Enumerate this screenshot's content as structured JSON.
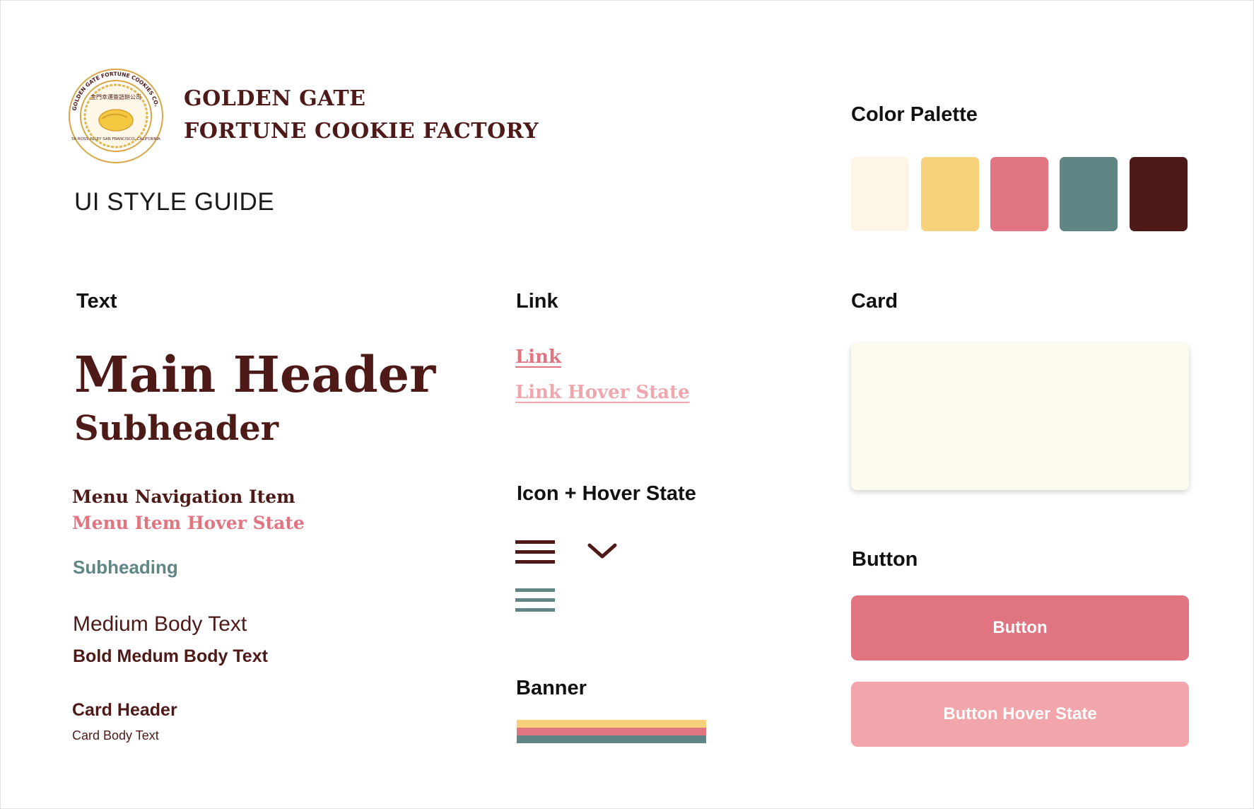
{
  "brand": {
    "line1": "GOLDEN GATE",
    "line2": "FORTUNE COOKIE FACTORY",
    "logo_ring_text": "GOLDEN GATE FORTUNE COOKIES CO.",
    "logo_bottom_text": "56 ROSS ALLEY SAN FRANCISCO, CALIFORNIA",
    "logo_chinese": "金門幸運簽語餅公司"
  },
  "guide_title": "UI STYLE GUIDE",
  "sections": {
    "text": "Text",
    "link": "Link",
    "icon": "Icon + Hover State",
    "banner": "Banner",
    "color_palette": "Color Palette",
    "card": "Card",
    "button": "Button"
  },
  "text_samples": {
    "main_header": "Main Header",
    "subheader": "Subheader",
    "menu_item": "Menu Navigation Item",
    "menu_hover": "Menu Item Hover State",
    "subheading": "Subheading",
    "medium_body": "Medium Body Text",
    "bold_body": "Bold Medum Body Text",
    "card_header": "Card Header",
    "card_body": "Card Body Text"
  },
  "links": {
    "link": "Link",
    "link_hover": "Link Hover State"
  },
  "icons": {
    "menu": "hamburger-menu-icon",
    "menu_hover": "hamburger-menu-hover-icon",
    "dropdown": "chevron-down-icon"
  },
  "colors": {
    "cream": "#fdf6e6",
    "yellow": "#f7d07a",
    "rose": "#e07480",
    "teal": "#5f8585",
    "maroon": "#4e1a18",
    "pink_light": "#f2a5aa",
    "card_bg": "#fdfaee"
  },
  "palette": [
    "#fdf6e6",
    "#f7d07a",
    "#e07480",
    "#5f8585",
    "#4e1a18"
  ],
  "banner_stripes": [
    "#f7d07a",
    "#e07480",
    "#5f8585"
  ],
  "buttons": {
    "primary": "Button",
    "hover": "Button Hover State"
  }
}
